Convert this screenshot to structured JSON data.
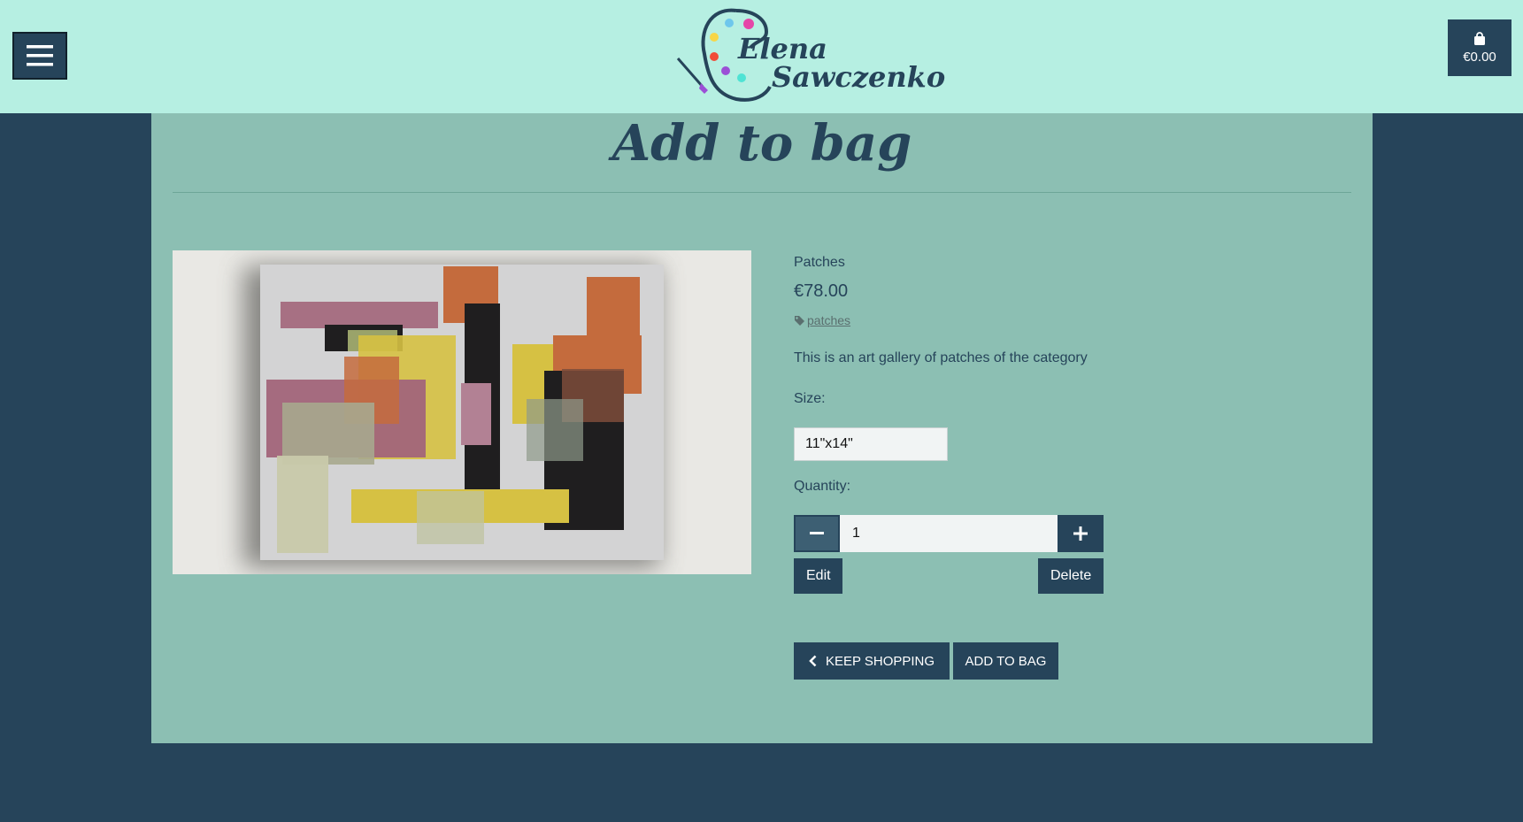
{
  "header": {
    "brand_line1": "Elena",
    "brand_line2": "Sawczenko",
    "menu_icon": "hamburger-icon",
    "bag_icon": "shopping-bag-icon",
    "bag_total": "€0.00"
  },
  "page": {
    "title": "Add to bag"
  },
  "product": {
    "name": "Patches",
    "price": "€78.00",
    "tag_icon": "tag-icon",
    "tag": "patches",
    "description": "This is an art gallery of patches of the category",
    "size_label": "Size:",
    "size_value": "11\"x14\"",
    "quantity_label": "Quantity:",
    "quantity_value": "1"
  },
  "buttons": {
    "edit": "Edit",
    "delete": "Delete",
    "keep_shopping": "KEEP SHOPPING",
    "add_to_bag": "ADD TO BAG"
  },
  "colors": {
    "header_bg": "#b6efe2",
    "page_bg": "#26445a",
    "panel_bg": "#8cbfb3",
    "button_bg": "#26445a"
  }
}
